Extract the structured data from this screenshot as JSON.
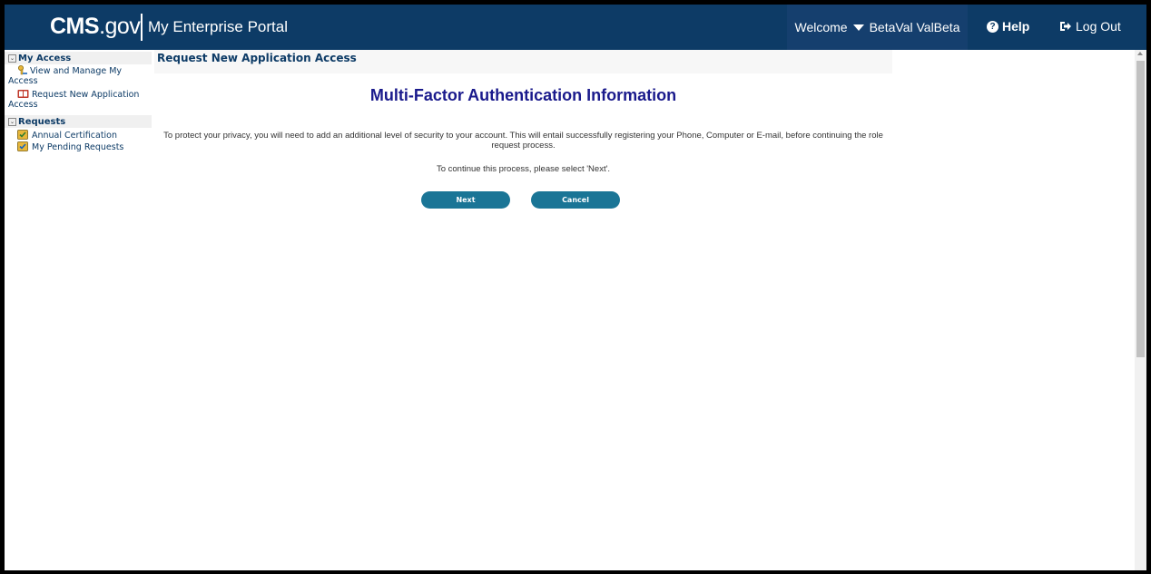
{
  "header": {
    "logo_main": "CMS",
    "logo_suffix": ".gov",
    "portal_title": "My Enterprise Portal",
    "welcome_label": "Welcome",
    "user_name": "BetaVal ValBeta",
    "help_label": "Help",
    "logout_label": "Log Out"
  },
  "sidebar": {
    "sections": [
      {
        "title": "My Access",
        "items": [
          {
            "label_line1": "View and Manage My",
            "label_line2": "Access",
            "icon": "key-icon"
          },
          {
            "label_line1": "Request New Application",
            "label_line2": "Access",
            "icon": "book-icon"
          }
        ]
      },
      {
        "title": "Requests",
        "items": [
          {
            "label": "Annual Certification",
            "icon": "certificate-icon"
          },
          {
            "label": "My Pending Requests",
            "icon": "pending-icon"
          }
        ]
      }
    ]
  },
  "content": {
    "breadcrumb": "Request New Application Access",
    "title": "Multi-Factor Authentication Information",
    "description": "To protect your privacy, you will need to add an additional level of security to your account. This will entail successfully registering your Phone, Computer or E-mail, before continuing the role request process.",
    "continue_text": "To continue this process, please select 'Next'.",
    "next_label": "Next",
    "cancel_label": "Cancel"
  },
  "colors": {
    "header_bg": "#0d3b66",
    "button_bg": "#1a7596",
    "title_color": "#1a1a8c"
  }
}
